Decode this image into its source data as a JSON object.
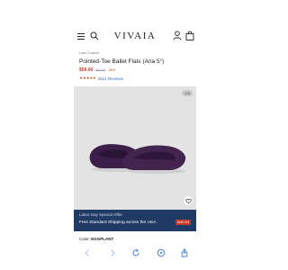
{
  "header": {
    "logo": "VIVAIA",
    "icons": [
      "menu-icon",
      "search-icon",
      "account-icon",
      "bag-icon"
    ]
  },
  "product": {
    "collection": "Last Chance",
    "title": "Pointed-Toe Ballet Flats (Aria 5°)",
    "price_sale": "$59.00",
    "price_original": "$97.00",
    "discount": "-39%",
    "stars": "★★★★★",
    "reviews": "2521 Reviews"
  },
  "gallery": {
    "counter": "1/8"
  },
  "promo": {
    "subtitle": "Labor Day Special Offer",
    "main": "Free Standard Shipping across the USA.",
    "badge": "Until 9/4"
  },
  "color": {
    "label": "Color:",
    "value": "EGGPLANT"
  },
  "browser_icons": [
    "back-icon",
    "forward-icon",
    "refresh-icon",
    "compass-icon",
    "share-icon"
  ],
  "colors": {
    "accent_red": "#c0392b",
    "banner_blue": "#1f3a64",
    "shoe_purple": "#3b1f4a",
    "link_blue": "#3a6db7"
  }
}
